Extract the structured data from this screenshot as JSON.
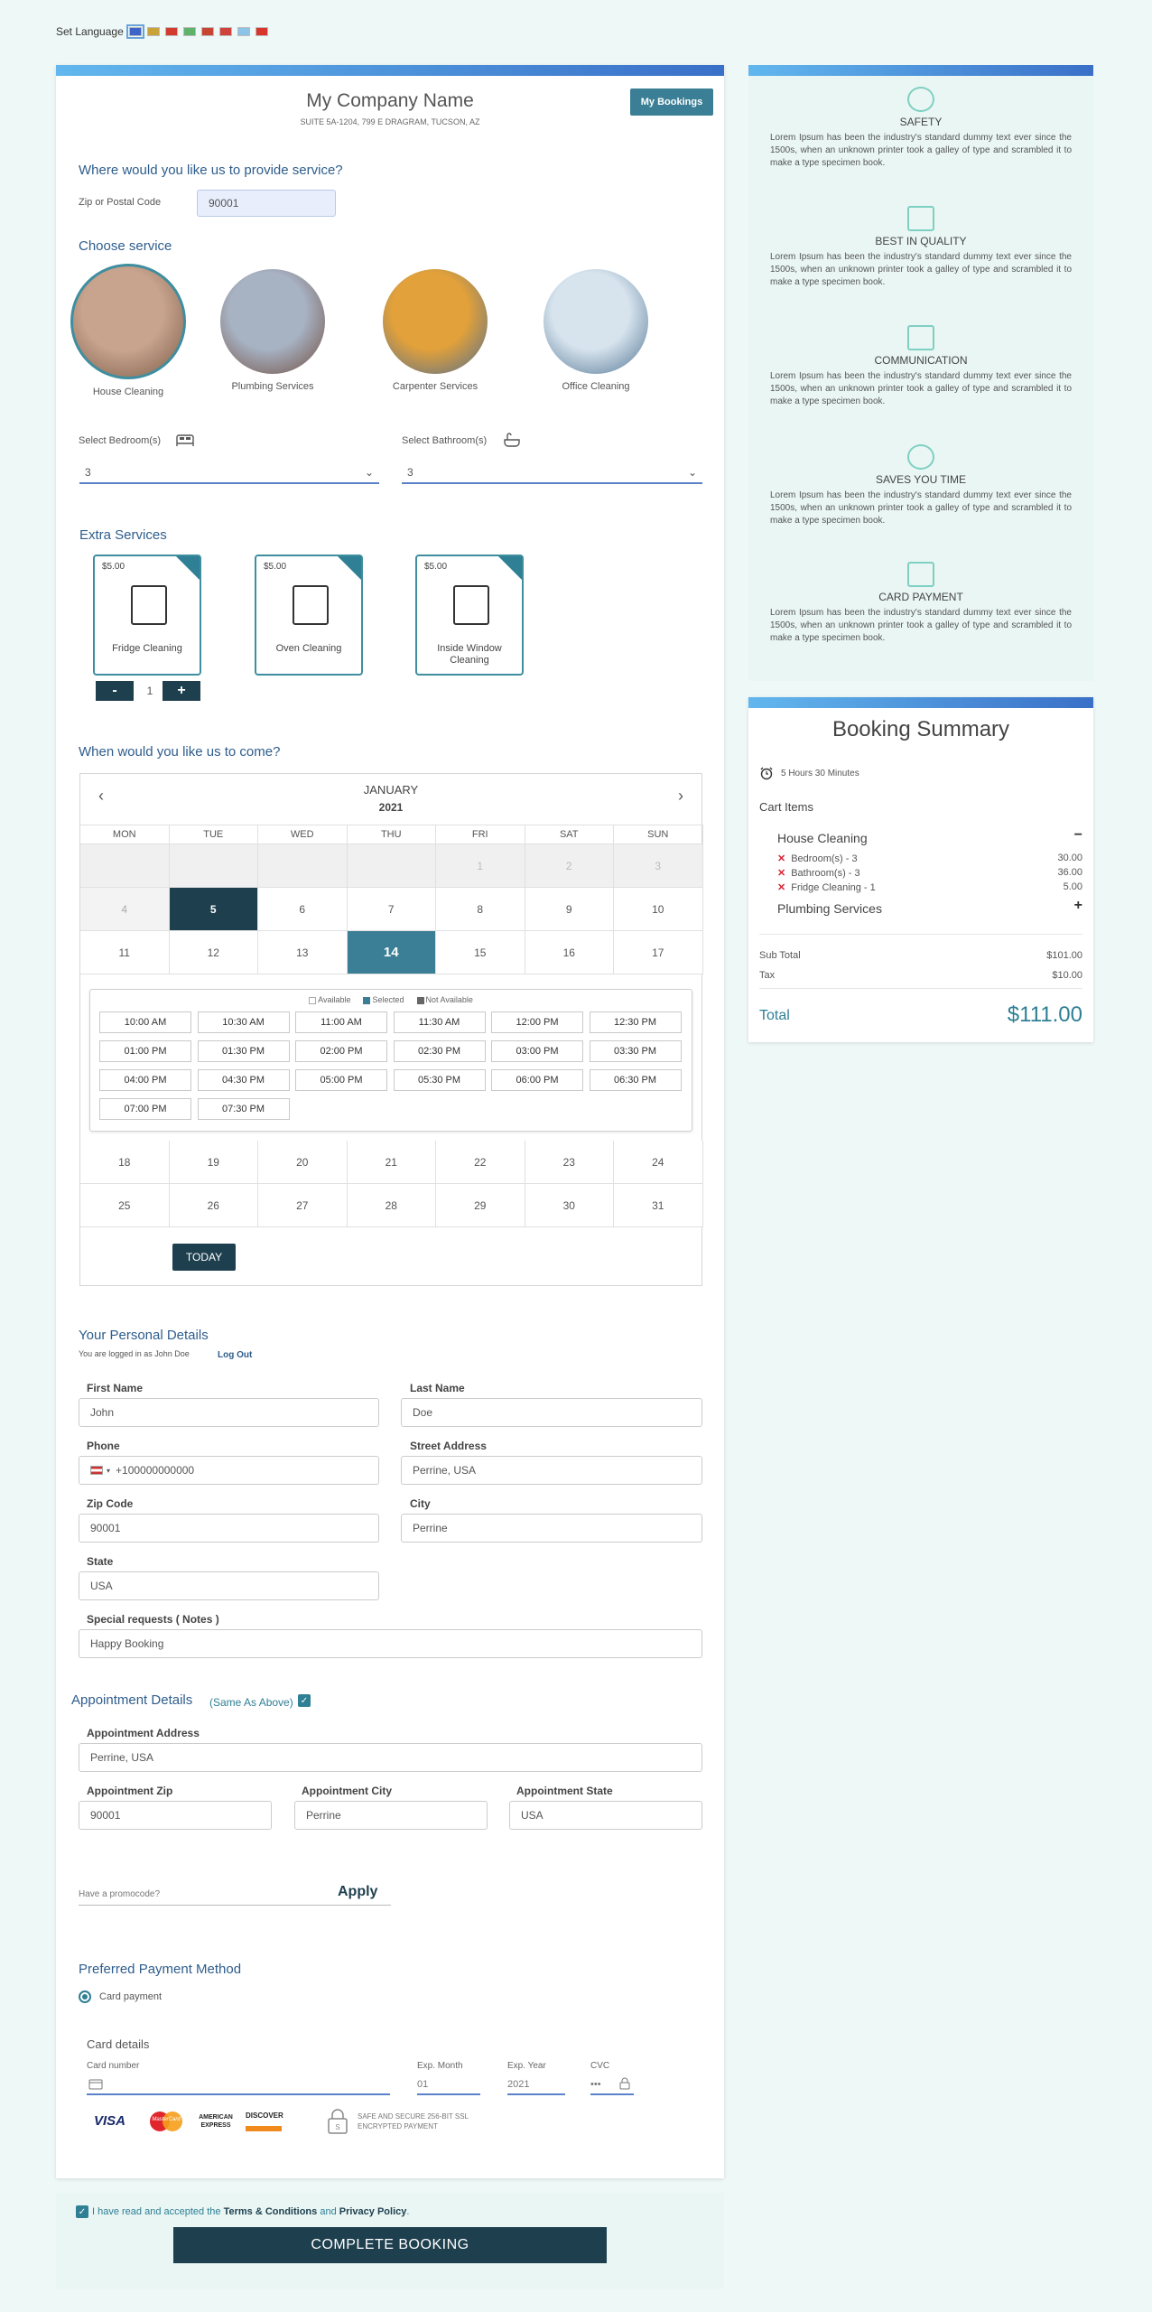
{
  "language": {
    "label": "Set Language",
    "flags": [
      "US",
      "DE",
      "ES",
      "IT",
      "PT",
      "RU",
      "AR",
      "CN"
    ],
    "flag_colors": [
      "#3d64c8",
      "#c9a33a",
      "#d33b2e",
      "#5fb26a",
      "#c84631",
      "#d0433c",
      "#8ac4e8",
      "#d8362c"
    ]
  },
  "header": {
    "company": "My Company Name",
    "address": "SUITE 5A-1204, 799 E DRAGRAM, TUCSON, AZ",
    "bookings_button": "My Bookings"
  },
  "location": {
    "heading": "Where would you like us to provide service?",
    "zip_label": "Zip or Postal Code",
    "zip_value": "90001"
  },
  "services": {
    "heading": "Choose service",
    "items": [
      {
        "label": "House Cleaning",
        "selected": true
      },
      {
        "label": "Plumbing Services"
      },
      {
        "label": "Carpenter Services"
      },
      {
        "label": "Office Cleaning"
      }
    ]
  },
  "rooms": {
    "bedroom_label": "Select Bedroom(s)",
    "bedroom_value": "3",
    "bathroom_label": "Select Bathroom(s)",
    "bathroom_value": "3"
  },
  "extras": {
    "heading": "Extra Services",
    "items": [
      {
        "price": "$5.00",
        "label": "Fridge Cleaning"
      },
      {
        "price": "$5.00",
        "label": "Oven Cleaning"
      },
      {
        "price": "$5.00",
        "label": "Inside Window Cleaning"
      }
    ],
    "minus": "-",
    "qty": "1",
    "plus": "+"
  },
  "calendar": {
    "heading": "When would you like us to come?",
    "month": "JANUARY",
    "year": "2021",
    "days": [
      "MON",
      "TUE",
      "WED",
      "THU",
      "FRI",
      "SAT",
      "SUN"
    ],
    "rows": [
      [
        "",
        "",
        "",
        "",
        "1",
        "2",
        "3"
      ],
      [
        "4",
        "5",
        "6",
        "7",
        "8",
        "9",
        "10"
      ],
      [
        "11",
        "12",
        "13",
        "14",
        "15",
        "16",
        "17"
      ],
      [
        "18",
        "19",
        "20",
        "21",
        "22",
        "23",
        "24"
      ],
      [
        "25",
        "26",
        "27",
        "28",
        "29",
        "30",
        "31"
      ]
    ],
    "legend": [
      "Available",
      "Selected",
      "Not Available"
    ],
    "slots": [
      "10:00 AM",
      "10:30 AM",
      "11:00 AM",
      "11:30 AM",
      "12:00 PM",
      "12:30 PM",
      "01:00 PM",
      "01:30 PM",
      "02:00 PM",
      "02:30 PM",
      "03:00 PM",
      "03:30 PM",
      "04:00 PM",
      "04:30 PM",
      "05:00 PM",
      "05:30 PM",
      "06:00 PM",
      "06:30 PM",
      "07:00 PM",
      "07:30 PM"
    ],
    "today": "TODAY"
  },
  "personal": {
    "heading": "Your Personal Details",
    "logged_in": "You are logged in as John Doe",
    "logout": "Log Out",
    "first_name_label": "First Name",
    "first_name": "John",
    "last_name_label": "Last Name",
    "last_name": "Doe",
    "phone_label": "Phone",
    "phone": "+100000000000",
    "street_label": "Street Address",
    "street": "Perrine, USA",
    "zip_label": "Zip Code",
    "zip": "90001",
    "city_label": "City",
    "city": "Perrine",
    "state_label": "State",
    "state": "USA",
    "notes_label": "Special requests ( Notes )",
    "notes": "Happy Booking"
  },
  "appointment": {
    "heading": "Appointment Details",
    "same": "(Same As Above)",
    "address_label": "Appointment Address",
    "address": "Perrine, USA",
    "zip_label": "Appointment Zip",
    "zip": "90001",
    "city_label": "Appointment City",
    "city": "Perrine",
    "state_label": "Appointment State",
    "state": "USA"
  },
  "promo": {
    "placeholder": "Have a promocode?",
    "apply": "Apply"
  },
  "payment": {
    "heading": "Preferred Payment Method",
    "method": "Card payment",
    "card_heading": "Card details",
    "card_number_label": "Card number",
    "exp_month_label": "Exp. Month",
    "exp_month": "01",
    "exp_year_label": "Exp. Year",
    "exp_year": "2021",
    "cvc_label": "CVC",
    "cvc": "•••",
    "brands": [
      "VISA",
      "MasterCard",
      "AMERICAN EXPRESS",
      "DISCOVER"
    ],
    "secure": "SAFE AND SECURE 256-BIT SSL ENCRYPTED PAYMENT"
  },
  "terms": {
    "prefix": "I have read and accepted the",
    "terms": "Terms & Conditions",
    "and": "and",
    "privacy": "Privacy Policy",
    "suffix": ".",
    "button": "COMPLETE BOOKING"
  },
  "features": [
    {
      "title": "SAFETY",
      "desc": "Lorem Ipsum has been the industry's standard dummy text ever since the 1500s, when an unknown printer took a galley of type and scrambled it to make a type specimen book."
    },
    {
      "title": "BEST IN QUALITY",
      "desc": "Lorem Ipsum has been the industry's standard dummy text ever since the 1500s, when an unknown printer took a galley of type and scrambled it to make a type specimen book."
    },
    {
      "title": "COMMUNICATION",
      "desc": "Lorem Ipsum has been the industry's standard dummy text ever since the 1500s, when an unknown printer took a galley of type and scrambled it to make a type specimen book."
    },
    {
      "title": "SAVES YOU TIME",
      "desc": "Lorem Ipsum has been the industry's standard dummy text ever since the 1500s, when an unknown printer took a galley of type and scrambled it to make a type specimen book."
    },
    {
      "title": "CARD PAYMENT",
      "desc": "Lorem Ipsum has been the industry's standard dummy text ever since the 1500s, when an unknown printer took a galley of type and scrambled it to make a type specimen book."
    }
  ],
  "summary": {
    "title": "Booking Summary",
    "duration": "5 Hours 30 Minutes",
    "cart_heading": "Cart Items",
    "service1": "House Cleaning",
    "lines": [
      {
        "label": "Bedroom(s) - 3",
        "price": "30.00"
      },
      {
        "label": "Bathroom(s) - 3",
        "price": "36.00"
      },
      {
        "label": "Fridge Cleaning - 1",
        "price": "5.00"
      }
    ],
    "service2": "Plumbing Services",
    "subtotal_label": "Sub Total",
    "subtotal": "$101.00",
    "tax_label": "Tax",
    "tax": "$10.00",
    "total_label": "Total",
    "total": "$111.00"
  },
  "colors": {
    "accent": "#2f7f95",
    "dark": "#1e3f4e",
    "link": "#2e5d8c"
  }
}
